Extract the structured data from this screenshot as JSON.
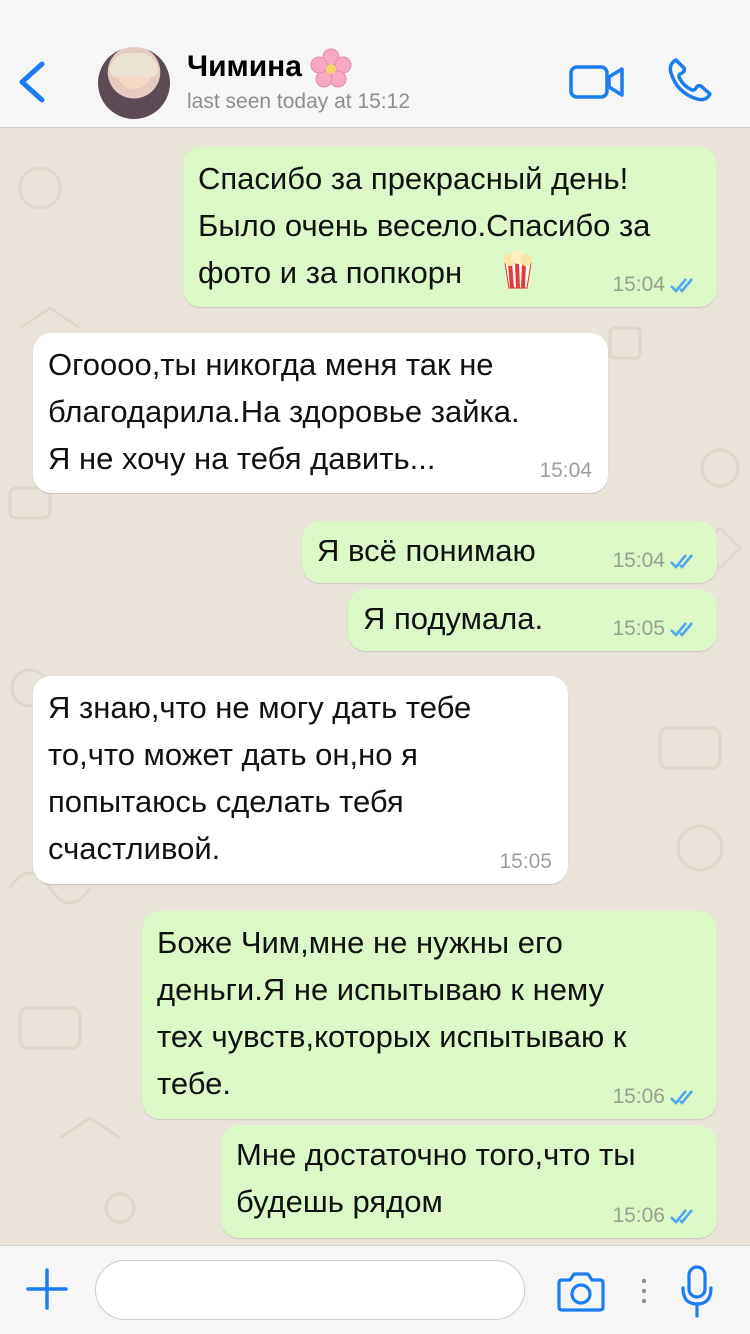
{
  "header": {
    "contact_name": "Чимина",
    "last_seen": "last seen today at 15:12"
  },
  "colors": {
    "accent": "#1a7df2",
    "outgoing_bubble": "#dcf8c6",
    "incoming_bubble": "#ffffff",
    "read_tick": "#4fa7ee",
    "chat_background": "#e9e3da"
  },
  "messages": [
    {
      "direction": "outgoing",
      "text": "Спасибо за прекрасный день!\nБыло очень весело.Спасибо за\nфото и за попкорн",
      "emoji_icon": "popcorn-icon",
      "time": "15:04",
      "status": "read"
    },
    {
      "direction": "incoming",
      "text": "Огоооо,ты никогда меня так не\nблагодарила.На здоровье зайка.\nЯ не хочу на тебя давить...",
      "time": "15:04"
    },
    {
      "direction": "outgoing",
      "text": "Я всё понимаю",
      "time": "15:04",
      "status": "read"
    },
    {
      "direction": "outgoing",
      "text": "Я подумала.",
      "time": "15:05",
      "status": "read"
    },
    {
      "direction": "incoming",
      "text": "Я знаю,что не могу дать тебе\nто,что может дать он,но я\nпопытаюсь сделать тебя\nсчастливой.",
      "time": "15:05"
    },
    {
      "direction": "outgoing",
      "text": "Боже Чим,мне не нужны его\nденьги.Я не испытываю к нему\nтех чувств,которых испытываю к\nтебе.",
      "time": "15:06",
      "status": "read"
    },
    {
      "direction": "outgoing",
      "text": "Мне достаточно того,что ты\nбудешь рядом",
      "time": "15:06",
      "status": "read"
    }
  ],
  "composer": {
    "input_value": "",
    "icons": [
      "plus-icon",
      "camera-icon",
      "microphone-icon"
    ]
  }
}
